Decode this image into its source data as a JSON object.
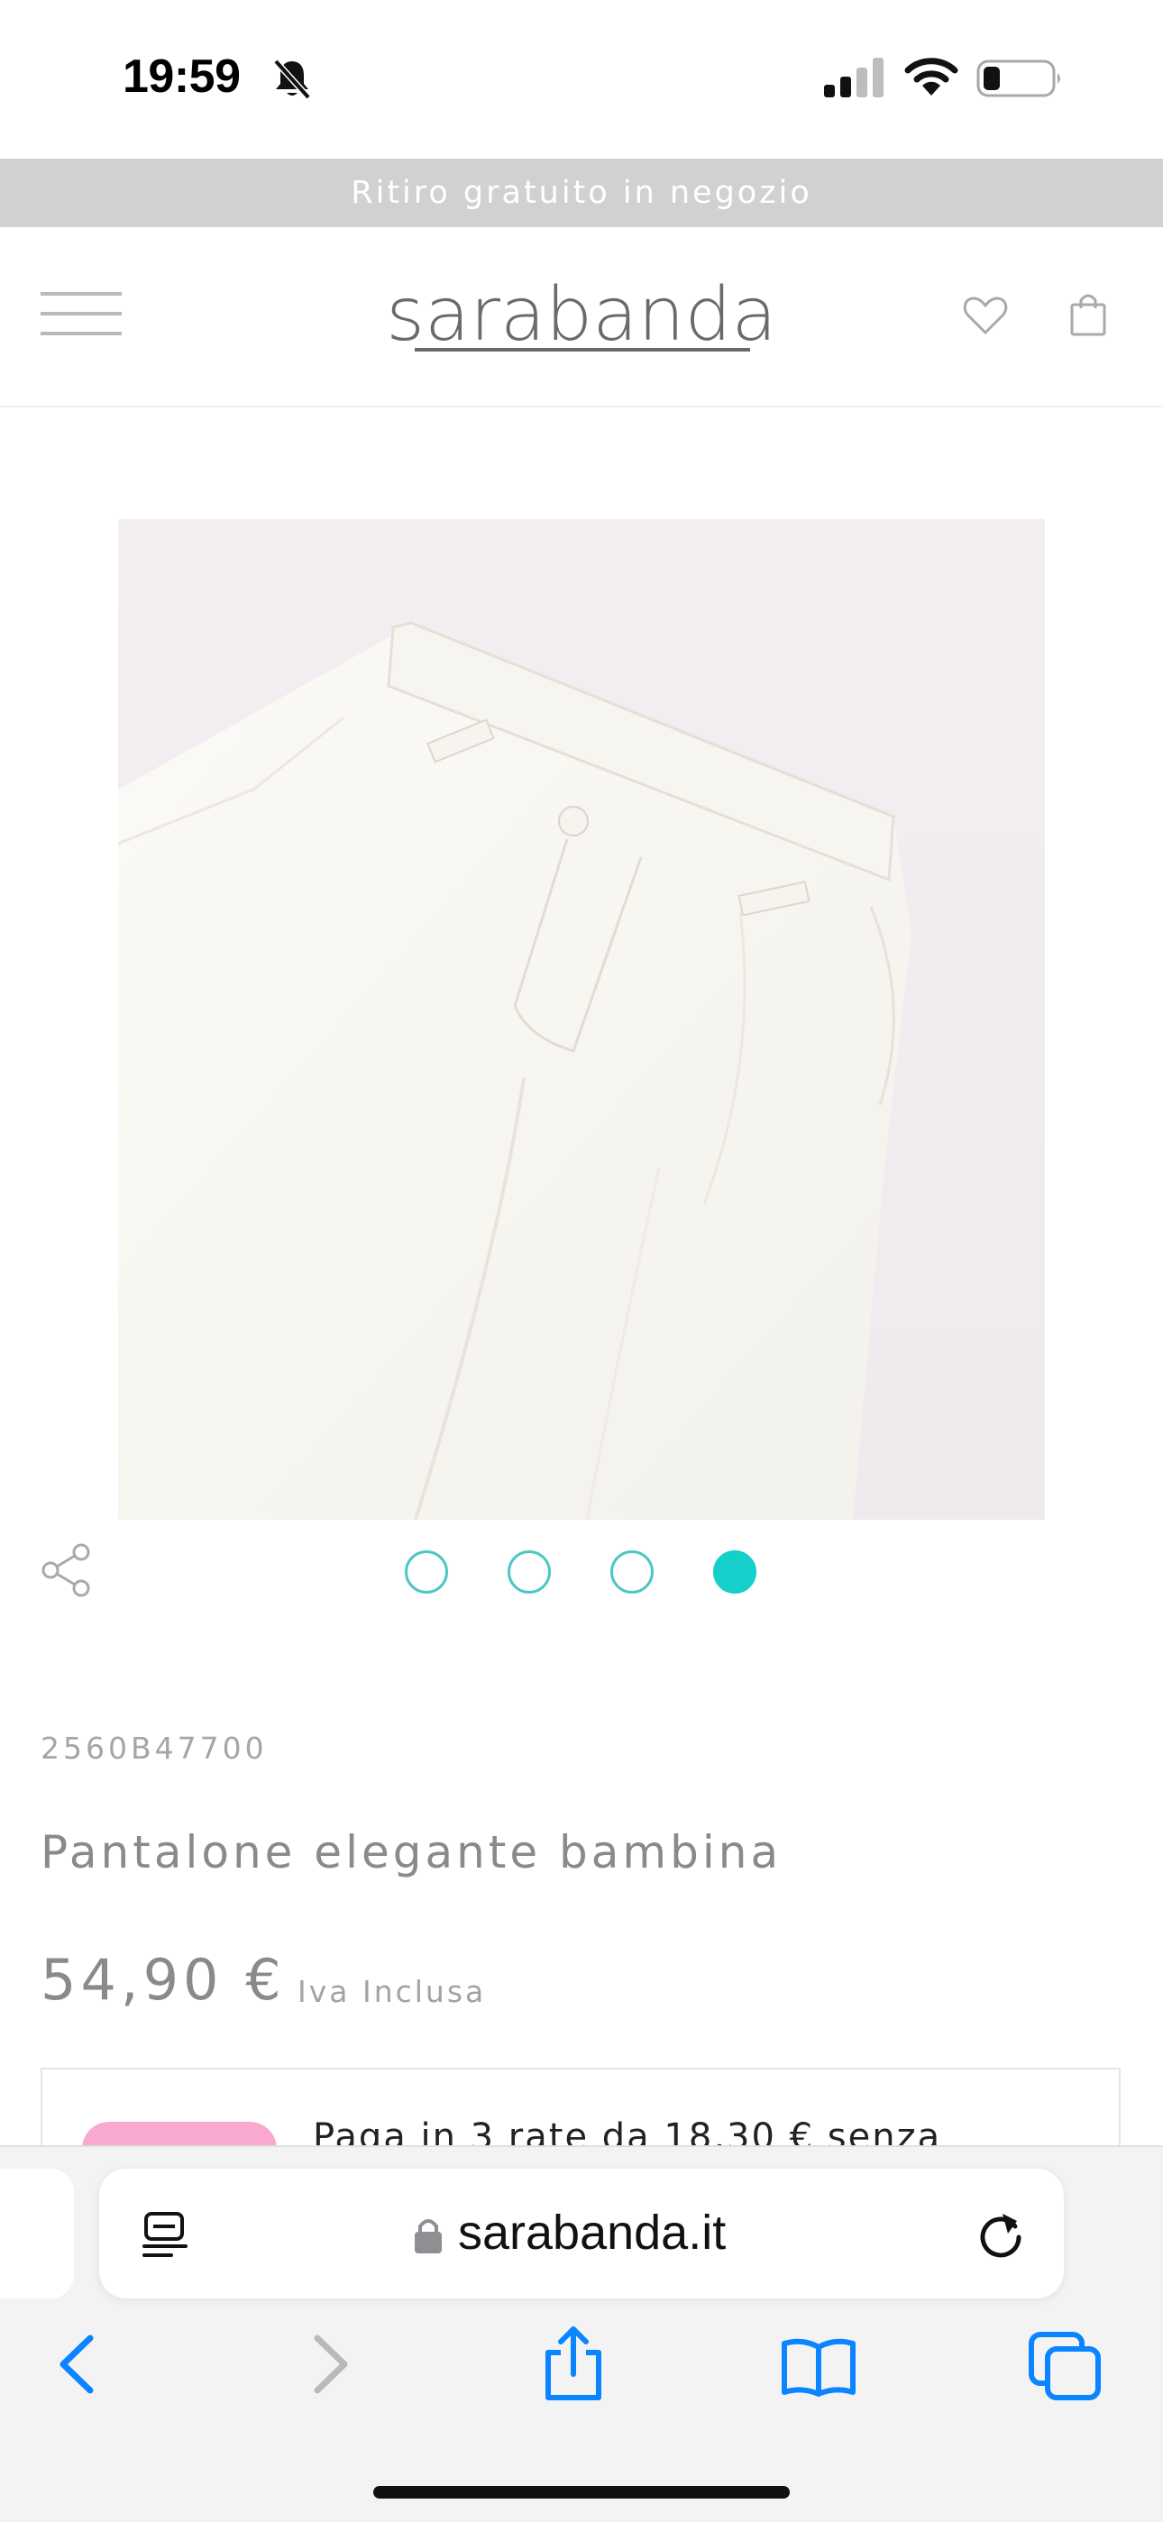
{
  "status_bar": {
    "time": "19:59",
    "icons": [
      "bell-slash-icon",
      "signal-icon",
      "wifi-icon",
      "battery-icon"
    ],
    "battery_level": 0.25
  },
  "promo_banner": {
    "text": "Ritiro gratuito in negozio"
  },
  "header": {
    "logo": "sarabanda",
    "icons": [
      "menu-icon",
      "heart-icon",
      "shopping-bag-icon"
    ]
  },
  "carousel": {
    "total": 4,
    "active_index": 4
  },
  "product": {
    "sku": "2560B47700",
    "name": "Pantalone elegante bambina",
    "price": "54,90 €",
    "vat_note": "Iva Inclusa",
    "installment_text": "Paga in 3 rate da 18,30 € senza"
  },
  "browser": {
    "url": "sarabanda.it",
    "toolbar": [
      "back-icon",
      "forward-icon",
      "share-icon",
      "bookmarks-icon",
      "tabs-icon"
    ]
  },
  "colors": {
    "accent": "#15cfca",
    "banner_bg": "#d1d1d4",
    "ios_blue": "#0a84ff",
    "klarna_pink": "#f9a9d0"
  }
}
